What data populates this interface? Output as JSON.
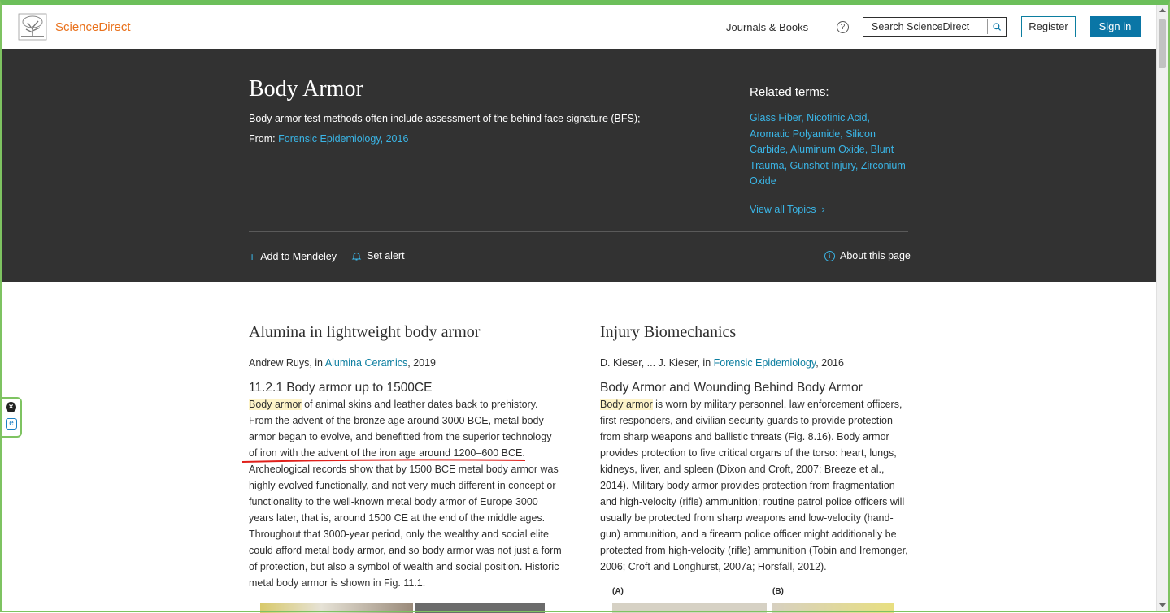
{
  "header": {
    "brand": "ScienceDirect",
    "journals_books": "Journals & Books",
    "help_glyph": "?",
    "search_placeholder": "Search ScienceDirect",
    "register": "Register",
    "sign_in": "Sign in"
  },
  "topic": {
    "title": "Body Armor",
    "description": "Body armor test methods often include assessment of the behind face signature (BFS);",
    "from_label": "From:",
    "from_source": "Forensic Epidemiology, 2016",
    "related_title": "Related terms:",
    "related_terms": "Glass Fiber, Nicotinic Acid, Aromatic Polyamide, Silicon Carbide, Aluminum Oxide, Blunt Trauma, Gunshot Injury, Zirconium Oxide",
    "view_all": "View all Topics",
    "add_mendeley": "Add to Mendeley",
    "set_alert": "Set alert",
    "about": "About this page"
  },
  "articles": [
    {
      "title": "Alumina in lightweight body armor",
      "author": "Andrew Ruys, in",
      "source": "Alumina Ceramics",
      "year": ", 2019",
      "section": "11.2.1 Body armor up to 1500CE",
      "highlight": "Body armor",
      "text_rest": " of animal skins and leather dates back to prehistory. From the advent of the bronze age around 3000 BCE, metal body armor began to evolve, and benefitted from the superior technology of iron with the advent of the iron age around 1200–600 BCE. Archeological records show that by 1500 BCE metal body armor was highly evolved functionally, and not very much different in concept or functionality to the well-known metal body armor of Europe 3000 years later, that is, around 1500 CE at the end of the middle ages. Throughout that 3000-year period, only the wealthy and social elite could afford metal body armor, and so body armor was not just a form of protection, but also a symbol of wealth and social position. Historic metal body armor is shown in Fig. 11.1."
    },
    {
      "title": "Injury Biomechanics",
      "author": "D. Kieser, ... J. Kieser, in",
      "source": "Forensic Epidemiology",
      "year": ", 2016",
      "section": "Body Armor and Wounding Behind Body Armor",
      "highlight": "Body armor",
      "text_a": " is worn by military personnel, law enforcement officers, first ",
      "text_link": "responders",
      "text_b": ", and civilian security guards to provide protection from sharp weapons and ballistic threats (Fig. 8.16). Body armor provides protection to five critical organs of the torso: heart, lungs, kidneys, liver, and spleen (Dixon and Croft, 2007; Breeze et al., 2014). Military body armor provides protection from fragmentation and high-velocity (rifle) ammunition; routine patrol police officers will usually be protected from sharp weapons and low-velocity (hand-gun) ammunition, and a firearm police officer might additionally be protected from high-velocity (rifle) ammunition (Tobin and Iremonger, 2006; Croft and Longhurst, 2007a; Horsfall, 2012).",
      "fig_a": "(A)",
      "fig_b": "(B)"
    }
  ],
  "widget": {
    "close": "×",
    "e": "e"
  }
}
